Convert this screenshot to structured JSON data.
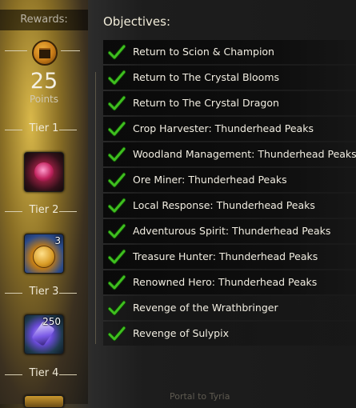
{
  "rewards": {
    "header": "Rewards:",
    "points_value": "25",
    "points_label": "Points",
    "tiers": [
      {
        "label": "Tier 1",
        "quantity": ""
      },
      {
        "label": "Tier 2",
        "quantity": "3"
      },
      {
        "label": "Tier 3",
        "quantity": "250"
      },
      {
        "label": "Tier 4",
        "quantity": ""
      }
    ]
  },
  "objectives": {
    "title": "Objectives:",
    "items": [
      {
        "label": "Return to Scion & Champion",
        "done": true
      },
      {
        "label": "Return to The Crystal Blooms",
        "done": true
      },
      {
        "label": "Return to The Crystal Dragon",
        "done": true
      },
      {
        "label": "Crop Harvester: Thunderhead Peaks",
        "done": true
      },
      {
        "label": "Woodland Management: Thunderhead Peaks",
        "done": true
      },
      {
        "label": "Ore Miner: Thunderhead Peaks",
        "done": true
      },
      {
        "label": "Local Response: Thunderhead Peaks",
        "done": true
      },
      {
        "label": "Adventurous Spirit: Thunderhead Peaks",
        "done": true
      },
      {
        "label": "Treasure Hunter: Thunderhead Peaks",
        "done": true
      },
      {
        "label": "Renowned Hero: Thunderhead Peaks",
        "done": true
      },
      {
        "label": "Revenge of the Wrathbringer",
        "done": true
      },
      {
        "label": "Revenge of Sulypix",
        "done": true
      }
    ]
  },
  "footer": {
    "map_label": "Portal to Tyria"
  },
  "colors": {
    "check_green": "#3fbf1f",
    "accent_gold": "#d9b84a"
  },
  "icons": {
    "chest": "treasure-chest-icon",
    "check": "checkmark-icon"
  }
}
